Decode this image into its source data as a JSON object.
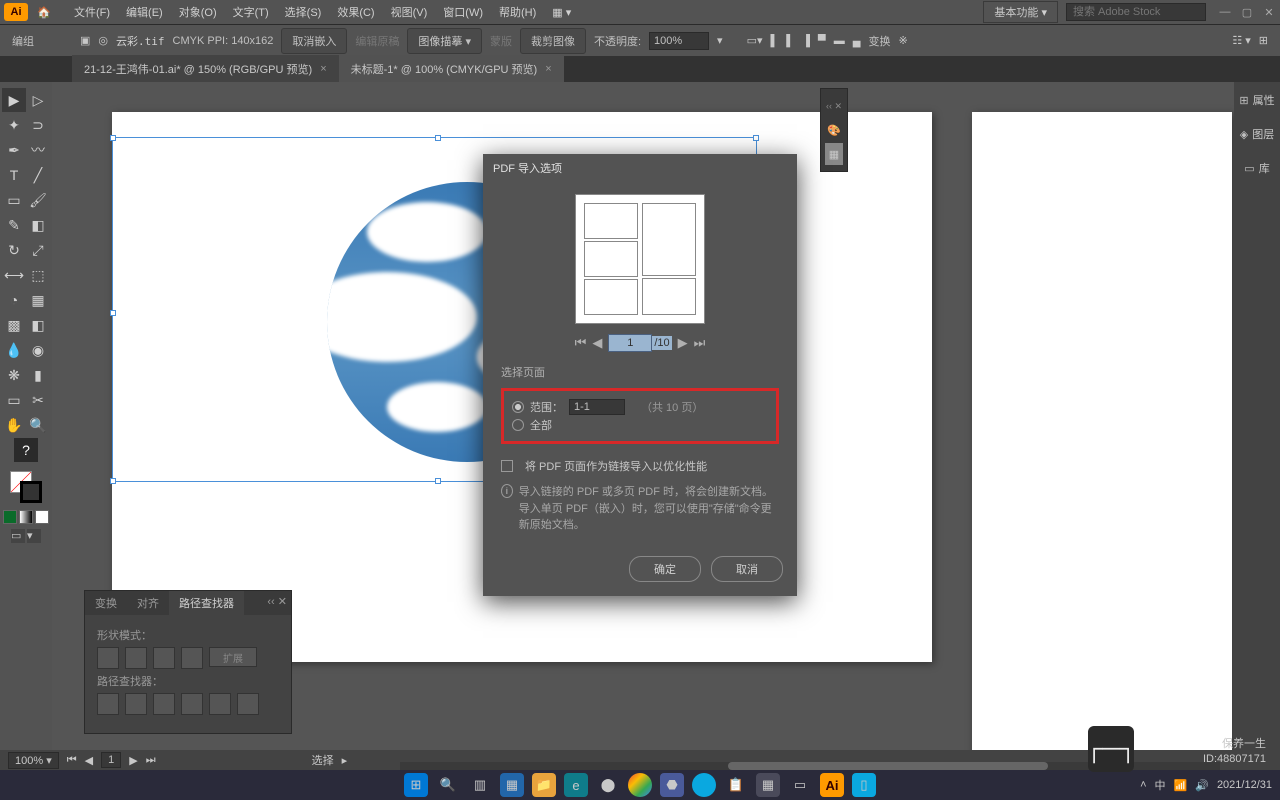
{
  "menubar": {
    "items": [
      "文件(F)",
      "编辑(E)",
      "对象(O)",
      "文字(T)",
      "选择(S)",
      "效果(C)",
      "视图(V)",
      "窗口(W)",
      "帮助(H)"
    ],
    "workspace": "基本功能",
    "search_placeholder": "搜索 Adobe Stock"
  },
  "controlbar": {
    "mode": "编组",
    "filename": "云彩.tif",
    "color_info": "CMYK PPI: 140x162",
    "btn_cancel_embed": "取消嵌入",
    "btn_edit_original_disabled": "编辑原稿",
    "tracing": "图像描摹",
    "masking_disabled": "蒙版",
    "crop": "裁剪图像",
    "opacity_label": "不透明度:",
    "opacity_value": "100%",
    "transform": "变换"
  },
  "tabs": [
    {
      "label": "21-12-王鸿伟-01.ai* @ 150% (RGB/GPU 预览)",
      "active": false
    },
    {
      "label": "未标题-1* @ 100% (CMYK/GPU 预览)",
      "active": true
    }
  ],
  "right_panels": [
    "属性",
    "图层",
    "库"
  ],
  "dialog": {
    "title": "PDF 导入选项",
    "page_current": "1",
    "page_total": "/10",
    "section_label": "选择页面",
    "range_label": "范围：",
    "range_value": "1-1",
    "total_pages": "（共 10 页）",
    "all_label": "全部",
    "link_checkbox": "将 PDF 页面作为链接导入以优化性能",
    "info_line1": "导入链接的 PDF 或多页 PDF 时，将会创建新文档。",
    "info_line2": "导入单页 PDF（嵌入）时，您可以使用\"存储\"命令更新原始文档。",
    "ok": "确定",
    "cancel": "取消"
  },
  "pathfinder": {
    "tabs": [
      "变换",
      "对齐",
      "路径查找器"
    ],
    "shape_modes": "形状模式：",
    "expand": "扩展",
    "pathfinders": "路径查找器："
  },
  "statusbar": {
    "zoom": "100%",
    "page": "1",
    "select": "选择"
  },
  "watermark": {
    "text": "保养一生",
    "id": "ID:48807171"
  },
  "taskbar": {
    "lang": "中",
    "time": "2021/12/31"
  }
}
